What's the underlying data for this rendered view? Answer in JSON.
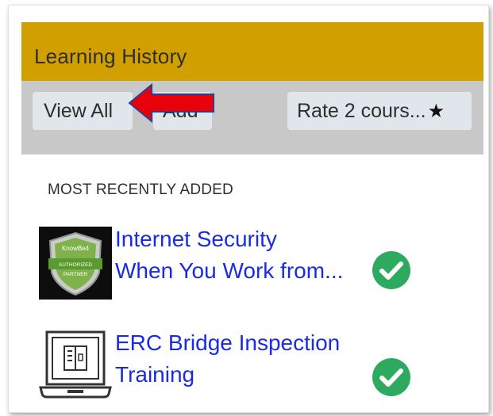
{
  "panel": {
    "title": "Learning History"
  },
  "toolbar": {
    "view_all_label": "View All",
    "add_label": "Add",
    "rate_label": "Rate 2 cours...",
    "rate_icon": "star-icon"
  },
  "section": {
    "label": "MOST RECENTLY ADDED"
  },
  "courses": [
    {
      "title_line1": "Internet Security",
      "title_line2": "When You Work from...",
      "status_icon": "check-circle-icon",
      "thumbnail_icon": "knowbe4-shield-badge",
      "badge_text_1": "KnowBe4",
      "badge_text_2": "AUTHORIZED",
      "badge_text_3": "PARTNER"
    },
    {
      "title_line1": "ERC Bridge Inspection",
      "title_line2": "Training",
      "status_icon": "check-circle-icon",
      "thumbnail_icon": "laptop-icon"
    }
  ],
  "colors": {
    "header_bg": "#d29f00",
    "toolbar_bg": "#c8c8c8",
    "button_bg": "#e1e6ec",
    "link": "#1a2be0",
    "check": "#2daa5f",
    "annotation_arrow": "#e8000b"
  }
}
